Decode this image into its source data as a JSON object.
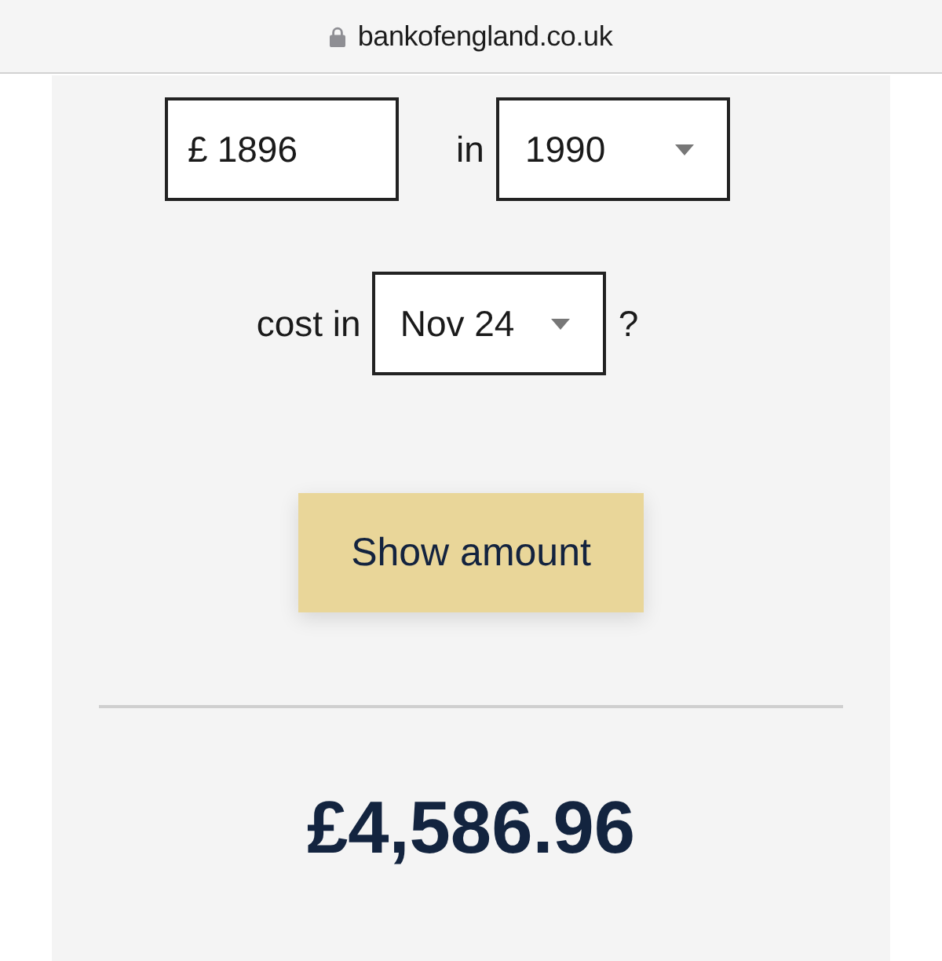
{
  "browser": {
    "url": "bankofengland.co.uk",
    "secure": true
  },
  "form": {
    "amount": {
      "currency": "£",
      "value": "1896"
    },
    "year_label": "in",
    "year_select": {
      "value": "1990"
    },
    "target_label": "cost in",
    "target_select": {
      "value": "Nov 24"
    },
    "suffix": "?",
    "button": "Show amount"
  },
  "result": {
    "amount": "£4,586.96"
  }
}
